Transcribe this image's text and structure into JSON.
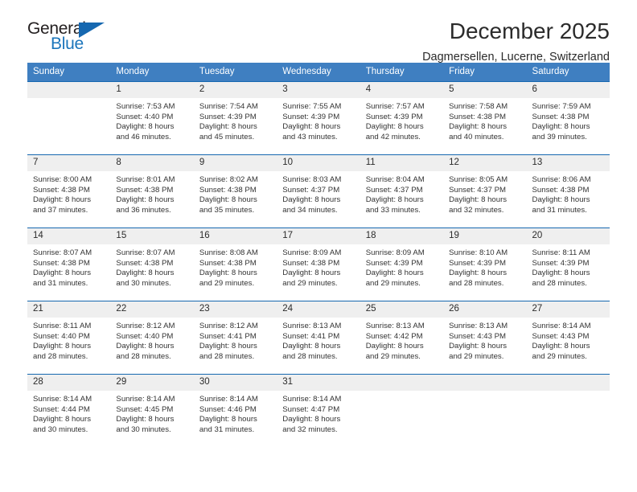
{
  "brand": {
    "name_primary": "General",
    "name_secondary": "Blue",
    "triangle_color": "#1668b0",
    "primary_color": "#231f20",
    "secondary_color": "#1b75bb"
  },
  "header": {
    "title": "December 2025",
    "subtitle": "Dagmersellen, Lucerne, Switzerland"
  },
  "theme": {
    "header_bg": "#3f7fc1",
    "header_text": "#ffffff",
    "row_divider": "#1668b0",
    "daynum_bg": "#efefef",
    "body_text": "#333333"
  },
  "weekdays": [
    "Sunday",
    "Monday",
    "Tuesday",
    "Wednesday",
    "Thursday",
    "Friday",
    "Saturday"
  ],
  "weeks": [
    [
      {
        "day": "",
        "lines": []
      },
      {
        "day": "1",
        "lines": [
          "Sunrise: 7:53 AM",
          "Sunset: 4:40 PM",
          "Daylight: 8 hours",
          "and 46 minutes."
        ]
      },
      {
        "day": "2",
        "lines": [
          "Sunrise: 7:54 AM",
          "Sunset: 4:39 PM",
          "Daylight: 8 hours",
          "and 45 minutes."
        ]
      },
      {
        "day": "3",
        "lines": [
          "Sunrise: 7:55 AM",
          "Sunset: 4:39 PM",
          "Daylight: 8 hours",
          "and 43 minutes."
        ]
      },
      {
        "day": "4",
        "lines": [
          "Sunrise: 7:57 AM",
          "Sunset: 4:39 PM",
          "Daylight: 8 hours",
          "and 42 minutes."
        ]
      },
      {
        "day": "5",
        "lines": [
          "Sunrise: 7:58 AM",
          "Sunset: 4:38 PM",
          "Daylight: 8 hours",
          "and 40 minutes."
        ]
      },
      {
        "day": "6",
        "lines": [
          "Sunrise: 7:59 AM",
          "Sunset: 4:38 PM",
          "Daylight: 8 hours",
          "and 39 minutes."
        ]
      }
    ],
    [
      {
        "day": "7",
        "lines": [
          "Sunrise: 8:00 AM",
          "Sunset: 4:38 PM",
          "Daylight: 8 hours",
          "and 37 minutes."
        ]
      },
      {
        "day": "8",
        "lines": [
          "Sunrise: 8:01 AM",
          "Sunset: 4:38 PM",
          "Daylight: 8 hours",
          "and 36 minutes."
        ]
      },
      {
        "day": "9",
        "lines": [
          "Sunrise: 8:02 AM",
          "Sunset: 4:38 PM",
          "Daylight: 8 hours",
          "and 35 minutes."
        ]
      },
      {
        "day": "10",
        "lines": [
          "Sunrise: 8:03 AM",
          "Sunset: 4:37 PM",
          "Daylight: 8 hours",
          "and 34 minutes."
        ]
      },
      {
        "day": "11",
        "lines": [
          "Sunrise: 8:04 AM",
          "Sunset: 4:37 PM",
          "Daylight: 8 hours",
          "and 33 minutes."
        ]
      },
      {
        "day": "12",
        "lines": [
          "Sunrise: 8:05 AM",
          "Sunset: 4:37 PM",
          "Daylight: 8 hours",
          "and 32 minutes."
        ]
      },
      {
        "day": "13",
        "lines": [
          "Sunrise: 8:06 AM",
          "Sunset: 4:38 PM",
          "Daylight: 8 hours",
          "and 31 minutes."
        ]
      }
    ],
    [
      {
        "day": "14",
        "lines": [
          "Sunrise: 8:07 AM",
          "Sunset: 4:38 PM",
          "Daylight: 8 hours",
          "and 31 minutes."
        ]
      },
      {
        "day": "15",
        "lines": [
          "Sunrise: 8:07 AM",
          "Sunset: 4:38 PM",
          "Daylight: 8 hours",
          "and 30 minutes."
        ]
      },
      {
        "day": "16",
        "lines": [
          "Sunrise: 8:08 AM",
          "Sunset: 4:38 PM",
          "Daylight: 8 hours",
          "and 29 minutes."
        ]
      },
      {
        "day": "17",
        "lines": [
          "Sunrise: 8:09 AM",
          "Sunset: 4:38 PM",
          "Daylight: 8 hours",
          "and 29 minutes."
        ]
      },
      {
        "day": "18",
        "lines": [
          "Sunrise: 8:09 AM",
          "Sunset: 4:39 PM",
          "Daylight: 8 hours",
          "and 29 minutes."
        ]
      },
      {
        "day": "19",
        "lines": [
          "Sunrise: 8:10 AM",
          "Sunset: 4:39 PM",
          "Daylight: 8 hours",
          "and 28 minutes."
        ]
      },
      {
        "day": "20",
        "lines": [
          "Sunrise: 8:11 AM",
          "Sunset: 4:39 PM",
          "Daylight: 8 hours",
          "and 28 minutes."
        ]
      }
    ],
    [
      {
        "day": "21",
        "lines": [
          "Sunrise: 8:11 AM",
          "Sunset: 4:40 PM",
          "Daylight: 8 hours",
          "and 28 minutes."
        ]
      },
      {
        "day": "22",
        "lines": [
          "Sunrise: 8:12 AM",
          "Sunset: 4:40 PM",
          "Daylight: 8 hours",
          "and 28 minutes."
        ]
      },
      {
        "day": "23",
        "lines": [
          "Sunrise: 8:12 AM",
          "Sunset: 4:41 PM",
          "Daylight: 8 hours",
          "and 28 minutes."
        ]
      },
      {
        "day": "24",
        "lines": [
          "Sunrise: 8:13 AM",
          "Sunset: 4:41 PM",
          "Daylight: 8 hours",
          "and 28 minutes."
        ]
      },
      {
        "day": "25",
        "lines": [
          "Sunrise: 8:13 AM",
          "Sunset: 4:42 PM",
          "Daylight: 8 hours",
          "and 29 minutes."
        ]
      },
      {
        "day": "26",
        "lines": [
          "Sunrise: 8:13 AM",
          "Sunset: 4:43 PM",
          "Daylight: 8 hours",
          "and 29 minutes."
        ]
      },
      {
        "day": "27",
        "lines": [
          "Sunrise: 8:14 AM",
          "Sunset: 4:43 PM",
          "Daylight: 8 hours",
          "and 29 minutes."
        ]
      }
    ],
    [
      {
        "day": "28",
        "lines": [
          "Sunrise: 8:14 AM",
          "Sunset: 4:44 PM",
          "Daylight: 8 hours",
          "and 30 minutes."
        ]
      },
      {
        "day": "29",
        "lines": [
          "Sunrise: 8:14 AM",
          "Sunset: 4:45 PM",
          "Daylight: 8 hours",
          "and 30 minutes."
        ]
      },
      {
        "day": "30",
        "lines": [
          "Sunrise: 8:14 AM",
          "Sunset: 4:46 PM",
          "Daylight: 8 hours",
          "and 31 minutes."
        ]
      },
      {
        "day": "31",
        "lines": [
          "Sunrise: 8:14 AM",
          "Sunset: 4:47 PM",
          "Daylight: 8 hours",
          "and 32 minutes."
        ]
      },
      {
        "day": "",
        "lines": []
      },
      {
        "day": "",
        "lines": []
      },
      {
        "day": "",
        "lines": []
      }
    ]
  ]
}
